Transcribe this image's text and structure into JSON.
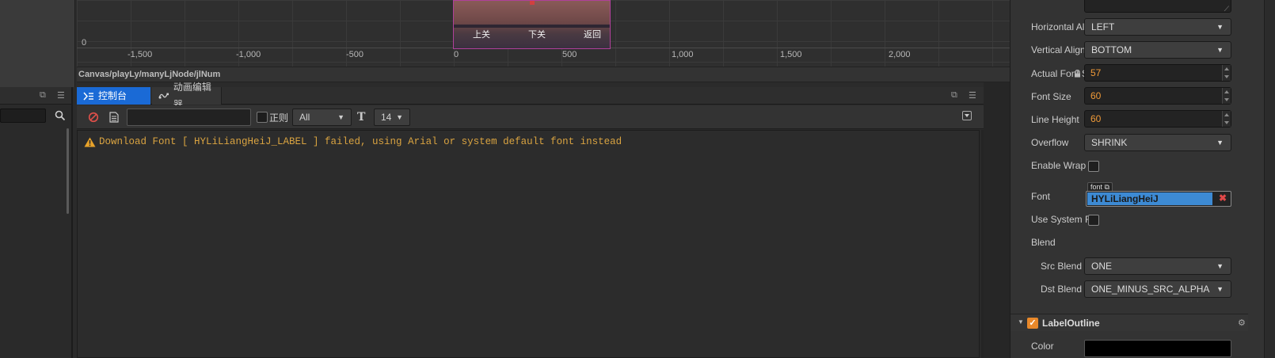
{
  "scene": {
    "x_ticks": [
      "-1,500",
      "-1,000",
      "-500",
      "0",
      "500",
      "1,000",
      "1,500",
      "2,000"
    ],
    "y_zero": "0",
    "preview_labels": [
      "上关",
      "下关",
      "返回"
    ],
    "path": "Canvas/playLy/manyLjNode/jlNum"
  },
  "console": {
    "tabs": [
      {
        "label": "控制台",
        "icon": "console-icon"
      },
      {
        "label": "动画编辑器",
        "icon": "animation-icon"
      }
    ],
    "filter_value": "",
    "regex_label": "正则",
    "level_value": "All",
    "font_size_value": "14",
    "log_message": "Download Font [ HYLiLiangHeiJ_LABEL ] failed, using Arial or system default font instead"
  },
  "inspector": {
    "rows": [
      {
        "label": "Horizontal Align",
        "value": "LEFT"
      },
      {
        "label": "Vertical Align",
        "value": "BOTTOM"
      },
      {
        "label": "Actual Font S..",
        "value": "57"
      },
      {
        "label": "Font Size",
        "value": "60"
      },
      {
        "label": "Line Height",
        "value": "60"
      },
      {
        "label": "Overflow",
        "value": "SHRINK"
      },
      {
        "label": "Enable Wrap T..",
        "value": ""
      },
      {
        "label": "Font",
        "value": "HYLiLiangHeiJ"
      },
      {
        "label": "Use System F...",
        "value": ""
      },
      {
        "label": "Blend",
        "value": ""
      },
      {
        "label": "Src Blend F...",
        "value": "ONE"
      },
      {
        "label": "Dst Blend F...",
        "value": "ONE_MINUS_SRC_ALPHA"
      },
      {
        "label": "Color",
        "value": ""
      }
    ],
    "font_asset_tag": "font",
    "component_title": "LabelOutline",
    "colors": {
      "accent": "#1a6ad6",
      "number": "#f09a38",
      "warning": "#d9a341",
      "font_asset": "#3d8ad3",
      "check": "#e8882a"
    }
  }
}
